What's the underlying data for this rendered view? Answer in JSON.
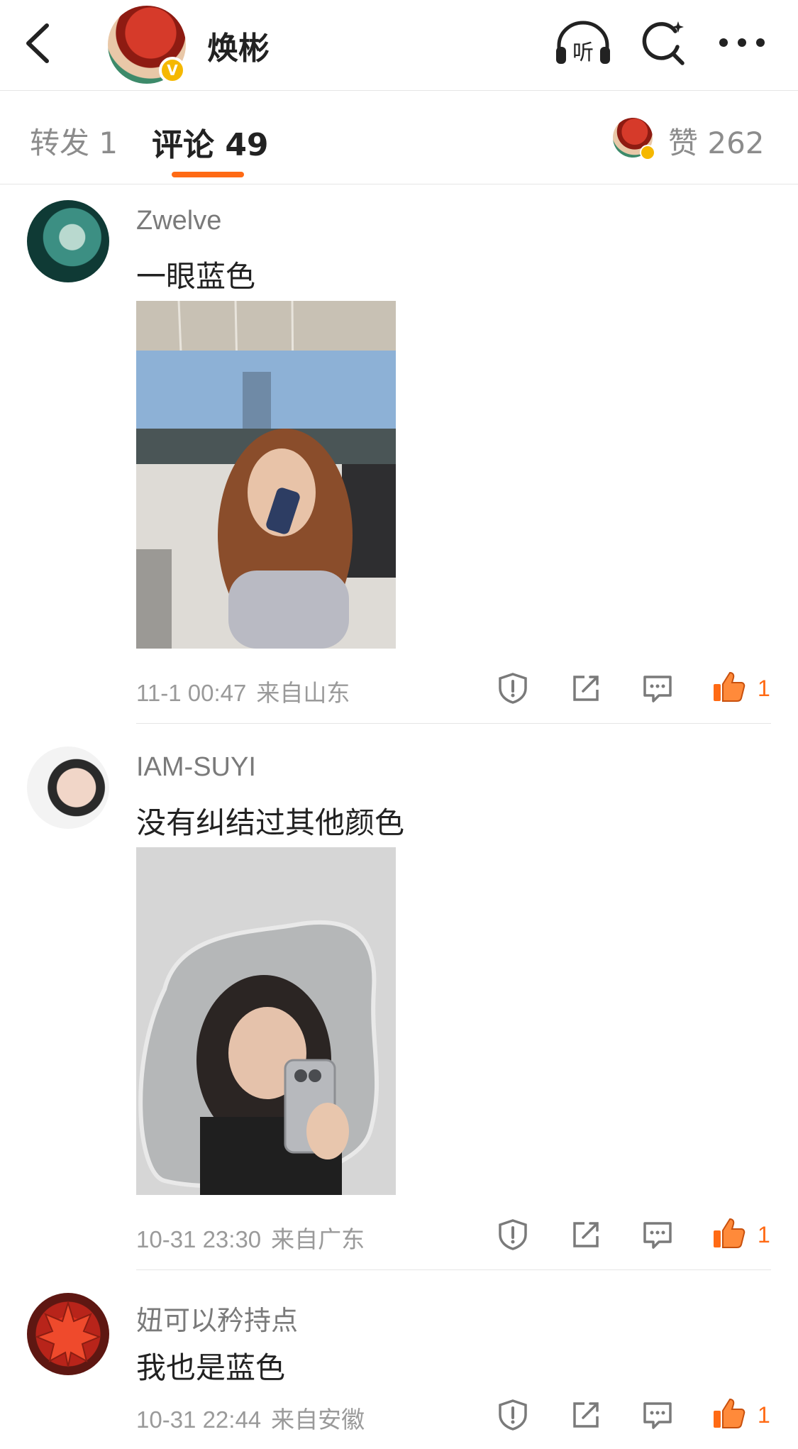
{
  "header": {
    "author_name": "焕彬",
    "verified_mark": "V",
    "listen_label": "听"
  },
  "tabs": {
    "repost": "转发 1",
    "comments": "评论 49",
    "likes": "赞 262"
  },
  "colors": {
    "accent": "#ff6a14",
    "verified": "#f5b800"
  },
  "comments": [
    {
      "user": "Zwelve",
      "text": "一眼蓝色",
      "date": "11-1 00:47",
      "location": "来自山东",
      "likes": "1",
      "has_photo": true
    },
    {
      "user": "IAM-SUYI",
      "text": "没有纠结过其他颜色",
      "date": "10-31 23:30",
      "location": "来自广东",
      "likes": "1",
      "has_photo": true
    },
    {
      "user": "妞可以矜持点",
      "text": "我也是蓝色",
      "date": "10-31 22:44",
      "location": "来自安徽",
      "likes": "1",
      "has_photo": false
    }
  ],
  "icons": [
    "back-icon",
    "headphones-icon",
    "search-icon",
    "more-icon",
    "report-icon",
    "share-icon",
    "reply-icon",
    "thumbs-up-icon"
  ]
}
